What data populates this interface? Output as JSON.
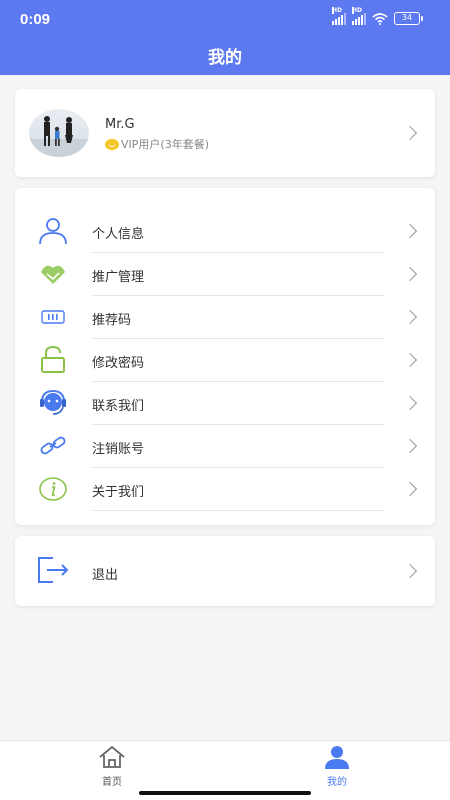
{
  "status_bar": {
    "time": "0:09",
    "battery": "34",
    "network1": "HD",
    "network2": "HD"
  },
  "header": {
    "title": "我的"
  },
  "profile": {
    "name": "Mr.G",
    "vip_text": "VIP用户(3年套餐)"
  },
  "menu": [
    {
      "label": "个人信息",
      "icon": "person-icon"
    },
    {
      "label": "推广管理",
      "icon": "handshake-icon"
    },
    {
      "label": "推荐码",
      "icon": "barcode-icon"
    },
    {
      "label": "修改密码",
      "icon": "lock-icon"
    },
    {
      "label": "联系我们",
      "icon": "headset-icon"
    },
    {
      "label": "注销账号",
      "icon": "link-icon"
    },
    {
      "label": "关于我们",
      "icon": "info-icon"
    }
  ],
  "logout": {
    "label": "退出",
    "icon": "logout-icon"
  },
  "tabbar": {
    "home": "首页",
    "mine": "我的"
  },
  "colors": {
    "primary": "#5d79f0",
    "accent_blue": "#4a7af0",
    "green": "#8bc34a"
  }
}
